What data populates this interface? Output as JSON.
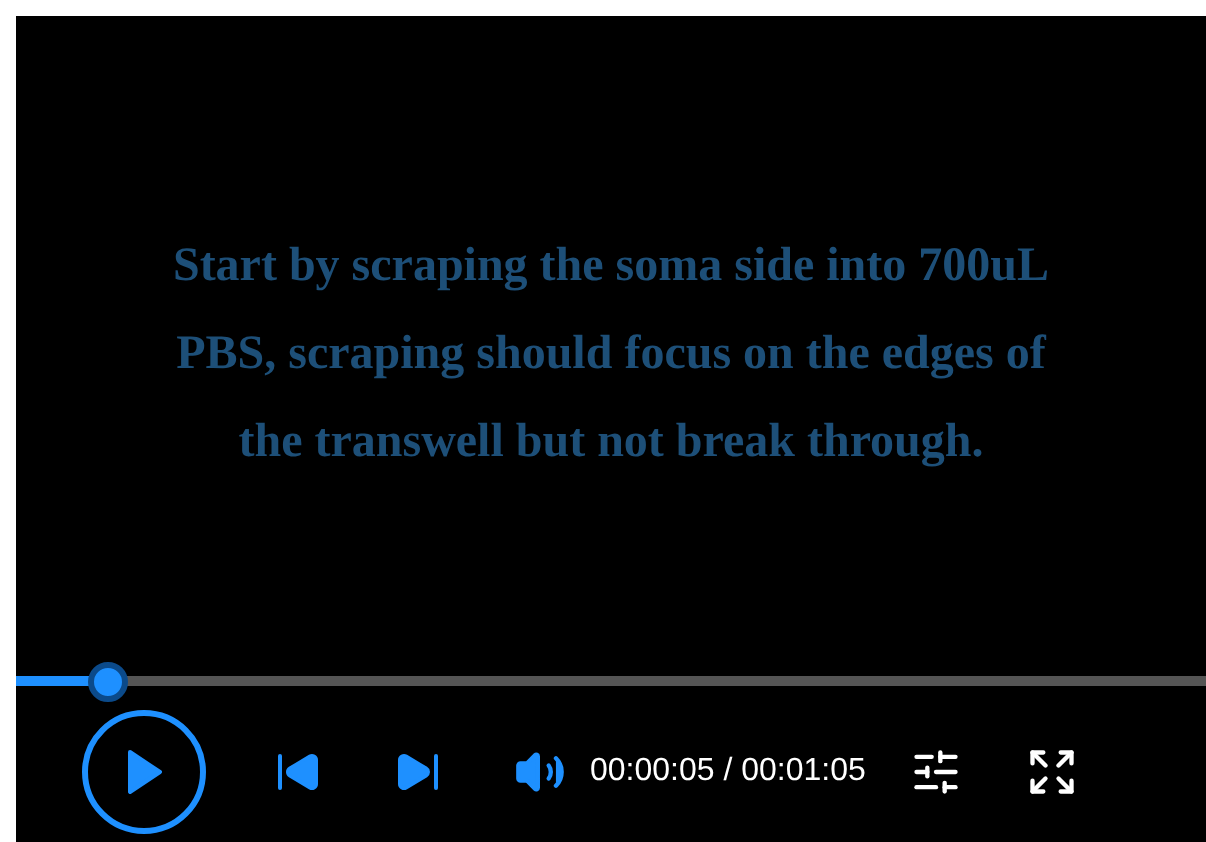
{
  "video": {
    "caption": "Start by scraping the soma side into 700uL PBS, scraping should focus on the edges of the transwell but not break through."
  },
  "player": {
    "playing": false,
    "progress": {
      "level": 0.077
    },
    "time": "00:00:05 / 00:01:05"
  }
}
